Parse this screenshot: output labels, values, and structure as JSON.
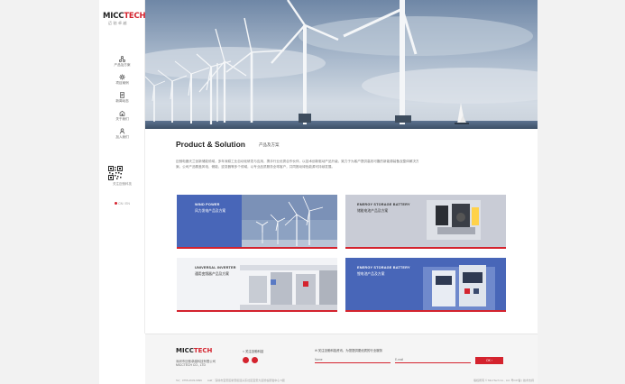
{
  "brand": {
    "logo_main": "MICC",
    "logo_accent": "TECH",
    "logo_sub": "迈驰卓越"
  },
  "sidebar": {
    "items": [
      {
        "label": "产品及方案",
        "icon": "network-icon"
      },
      {
        "label": "项目案例",
        "icon": "gear-icon"
      },
      {
        "label": "新闻动态",
        "icon": "document-icon"
      },
      {
        "label": "关于我们",
        "icon": "building-icon"
      },
      {
        "label": "加入我们",
        "icon": "user-icon"
      }
    ],
    "qr_label": "关注迈驰科技",
    "lang": "CN / EN"
  },
  "intro": {
    "title": "Product & Solution",
    "title_cn": "产品及方案",
    "text": "迈驰电器天兰创新储能领域，多年深耕工业自动化研发与应用，携手行业优秀合作伙伴，以技术创新驱动产品升级，致力于为客户提供高效可靠的新能源装备及整体解决方案。公司产品覆盖风电、储能、逆变器等多个领域，以专业品质服务全球客户，共同推动绿色能源可持续发展。"
  },
  "cards": [
    {
      "title": "WIND POWER",
      "subtitle": "风力发电产品及方案"
    },
    {
      "title": "ENERGY STORAGE BATTERY",
      "subtitle": "储能电池产品及方案"
    },
    {
      "title": "UNIVERSAL INVERTER",
      "subtitle": "通用变频器产品及方案"
    },
    {
      "title": "ENERGY STORAGE BATTERY",
      "subtitle": "锂电池产品及方案"
    }
  ],
  "footer": {
    "logo_main": "MICC",
    "logo_accent": "TECH",
    "company_cn": "深圳市迈驰卓越科技有限公司",
    "company_en": "MICCTECH CO., LTD",
    "follow_label": "关注迈驰科技",
    "message_label": "关注迈驰科技资讯，为您提供更优质的行业服务",
    "name_placeholder": "Name",
    "email_placeholder": "E-mail",
    "submit_label": "OK ›",
    "bottom_left": "Tel：0755-2633-9999　　Add：深圳市宝安区新安街道兴东社区宝安大道智谷研发中心 5层",
    "bottom_right": "版权所有 © MiccTech Co., Ltd. 粤ICP备 | 技术支持"
  },
  "colors": {
    "accent": "#d4232e",
    "card_blue": "#4866b8",
    "card_grey": "#c9ccd6"
  }
}
